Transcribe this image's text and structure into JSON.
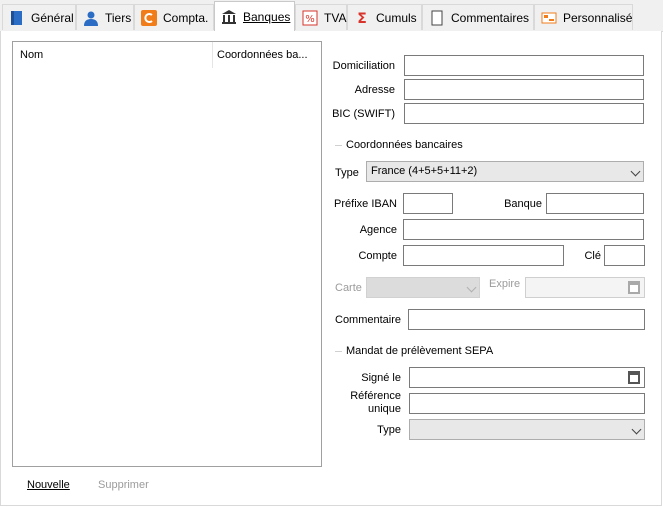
{
  "tabs": [
    {
      "label": "Général",
      "icon": "book-icon"
    },
    {
      "label": "Tiers",
      "icon": "person-icon"
    },
    {
      "label": "Compta.",
      "icon": "compta-icon"
    },
    {
      "label": "Banques",
      "icon": "bank-icon"
    },
    {
      "label": "TVA",
      "icon": "percent-icon"
    },
    {
      "label": "Cumuls",
      "icon": "sigma-icon"
    },
    {
      "label": "Commentaires",
      "icon": "document-icon"
    },
    {
      "label": "Personnalisé",
      "icon": "vip-card-icon"
    }
  ],
  "active_tab": "Banques",
  "list": {
    "col_nom": "Nom",
    "col_coord": "Coordonnées ba..."
  },
  "form": {
    "domiciliation_label": "Domiciliation",
    "adresse_label": "Adresse",
    "bic_label": "BIC (SWIFT)",
    "coord_group": "Coordonnées bancaires",
    "type_label": "Type",
    "type_value": "France (4+5+5+11+2)",
    "prefixe_label": "Préfixe IBAN",
    "banque_label": "Banque",
    "agence_label": "Agence",
    "compte_label": "Compte",
    "cle_label": "Clé",
    "carte_label": "Carte",
    "expire_label": "Expire",
    "commentaire_label": "Commentaire",
    "sepa_group": "Mandat de prélèvement SEPA",
    "signe_label": "Signé le",
    "reference_label_1": "Référence",
    "reference_label_2": "unique",
    "sepa_type_label": "Type"
  },
  "buttons": {
    "nouvelle": "Nouvelle",
    "supprimer": "Supprimer"
  },
  "colors": {
    "accent_blue": "#2b6cc4",
    "orange": "#f07d1a",
    "red": "#d9342b"
  }
}
